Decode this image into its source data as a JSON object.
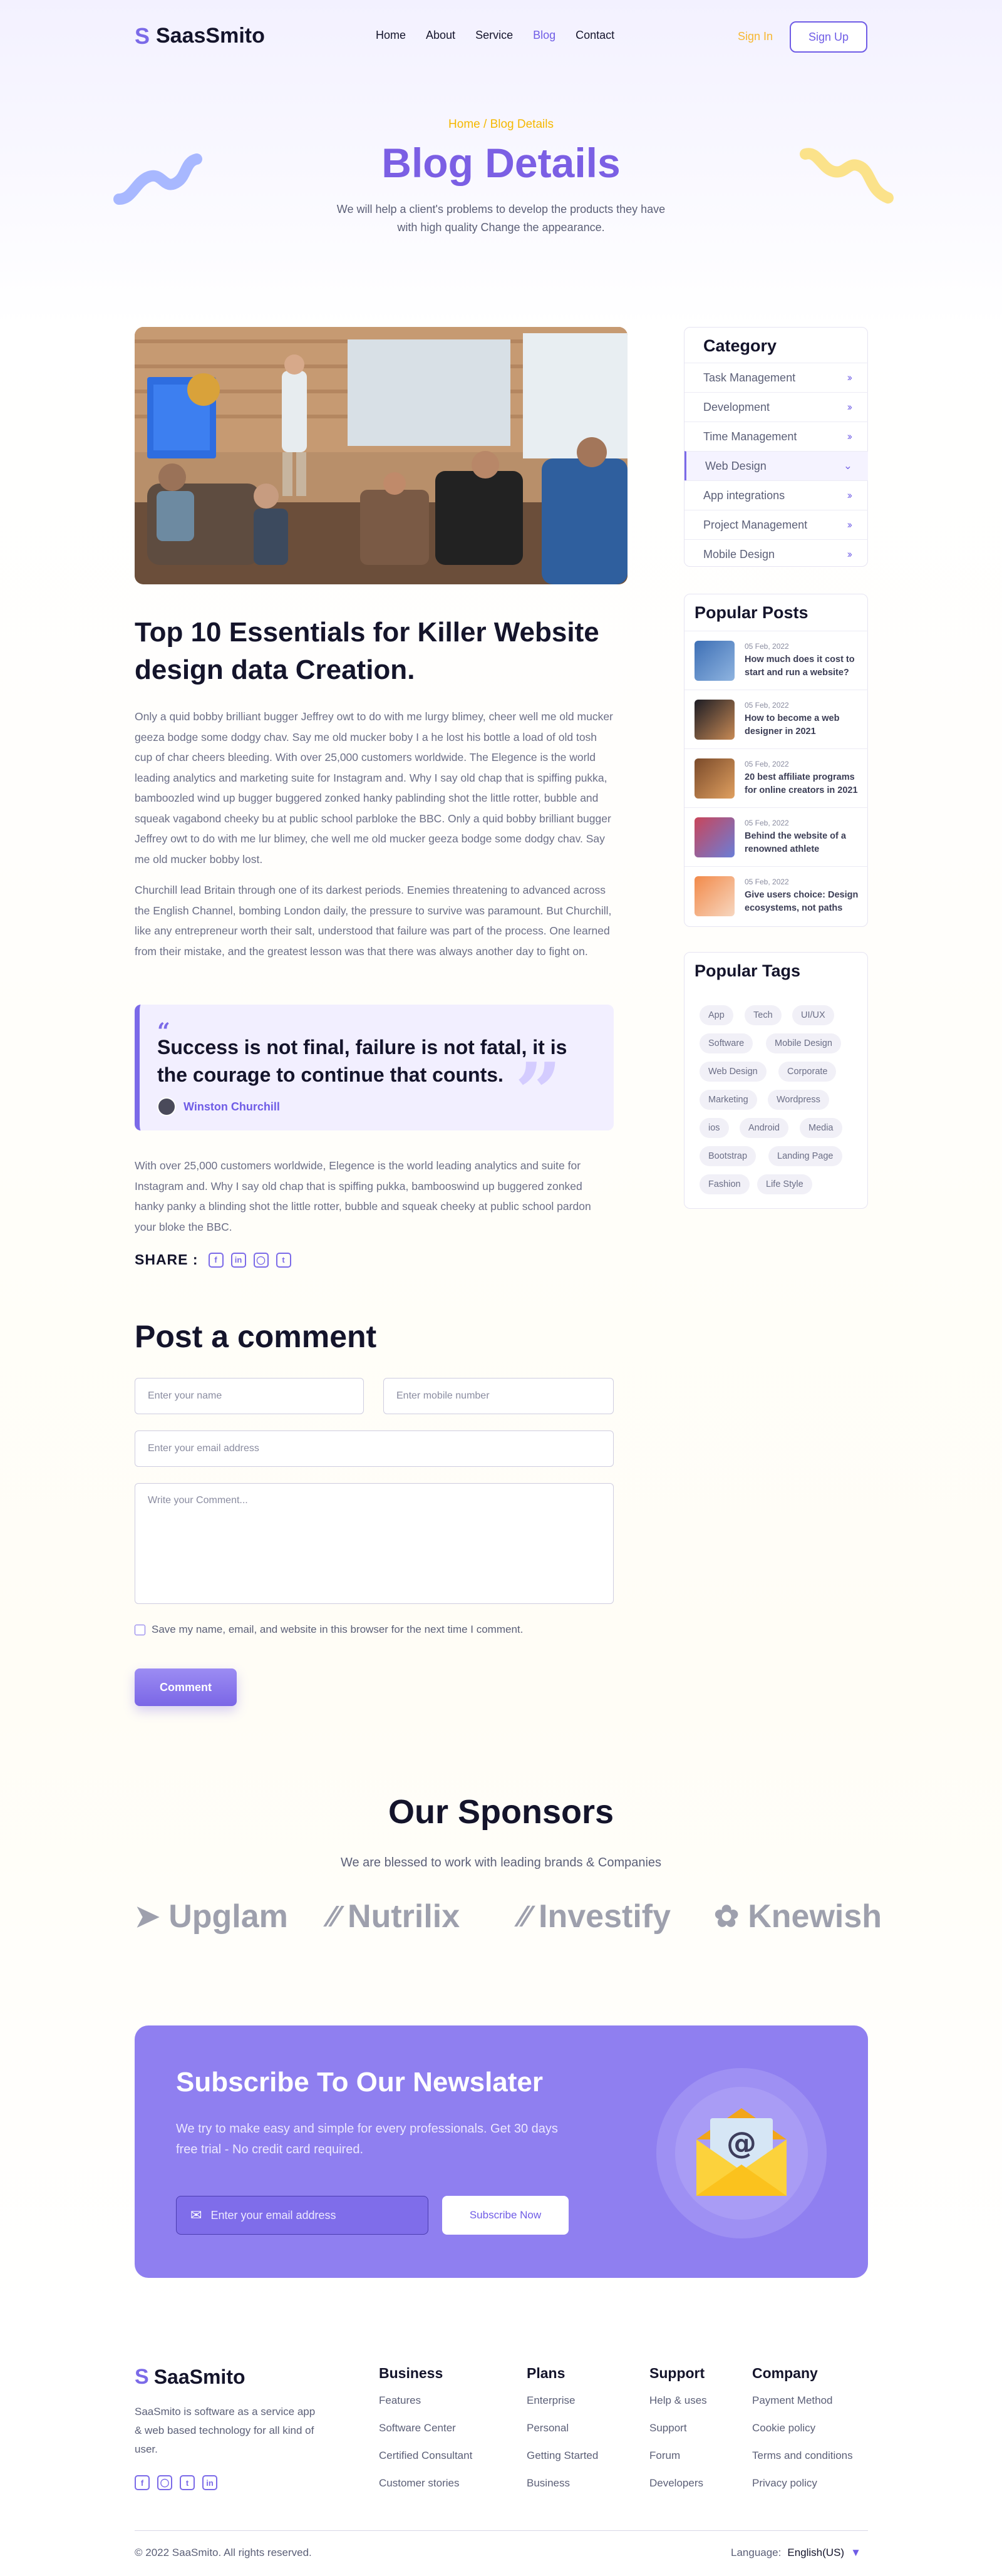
{
  "header": {
    "logo_text": "SaasSmito",
    "nav": [
      "Home",
      "About",
      "Service",
      "Blog",
      "Contact"
    ],
    "signin": "Sign In",
    "signup": "Sign Up"
  },
  "hero": {
    "breadcrumb": "Home / Blog Details",
    "title": "Blog Details",
    "subtitle": "We will help a client's problems to develop the products they have with high quality Change the appearance."
  },
  "article": {
    "title": "Top 10 Essentials for Killer Website design data Creation.",
    "para1": "Only a quid bobby brilliant bugger Jeffrey owt to do with me lurgy blimey, cheer well me old mucker geeza bodge some dodgy chav. Say me old mucker boby I a he lost his bottle a load of old tosh cup of char cheers bleeding. With over 25,000 customers worldwide. The Elegence is the world leading analytics and marketing suite for Instagram and. Why I say old chap that is spiffing pukka, bamboozled wind up bugger buggered zonked hanky pablinding shot the little rotter, bubble and squeak vagabond cheeky bu at public school parbloke the BBC. Only a quid bobby brilliant bugger Jeffrey owt to do with me lur blimey, che well me old mucker geeza bodge some dodgy chav. Say me old mucker bobby  lost.",
    "para2": "Churchill lead Britain through one of its darkest periods.  Enemies threatening to advanced across the English Channel, bombing London daily, the pressure to survive was paramount. But Churchill, like any entrepreneur worth their salt, understood that failure was part of the process. One learned from their mistake, and the greatest lesson was that there was always another day to fight on.",
    "quote": "Success is not final, failure is not fatal, it is the courage to continue that counts.",
    "quote_author": "Winston Churchill",
    "para3": "With over 25,000 customers worldwide, Elegence is the world leading analytics and suite for Instagram and. Why I say old chap that is spiffing pukka, bambooswind up buggered zonked hanky panky a blinding shot the little rotter, bubble and squeak cheeky at public school pardon your bloke the BBC.",
    "share_label": "SHARE :",
    "share_icons": [
      "facebook-icon",
      "linkedin-icon",
      "instagram-icon",
      "twitter-icon"
    ]
  },
  "comment": {
    "title": "Post a comment",
    "name_placeholder": "Enter your name",
    "mobile_placeholder": "Enter mobile number",
    "email_placeholder": "Enter your email address",
    "comment_placeholder": "Write your Comment...",
    "checkbox_label": "Save my name, email, and website in this browser for the next time I comment.",
    "button": "Comment"
  },
  "sidebar": {
    "category_title": "Category",
    "categories": [
      "Task Management",
      "Development",
      "Time Management",
      "Web Design",
      "App integrations",
      "Project Management",
      "Mobile Design"
    ],
    "active_category": "Web Design",
    "popular_title": "Popular Posts",
    "posts": [
      {
        "date": "05 Feb, 2022",
        "title": "How much does it cost to start and run a website?"
      },
      {
        "date": "05 Feb, 2022",
        "title": "How to become a web designer in 2021"
      },
      {
        "date": "05 Feb, 2022",
        "title": "20 best affiliate programs for online creators in 2021"
      },
      {
        "date": "05 Feb, 2022",
        "title": "Behind the website of a renowned athlete"
      },
      {
        "date": "05 Feb, 2022",
        "title": "Give users choice: Design ecosystems, not paths"
      }
    ],
    "tags_title": "Popular Tags",
    "tags": [
      "App",
      "Tech",
      "UI/UX",
      "Software",
      "Mobile Design",
      "Web Design",
      "Corporate",
      "Marketing",
      "Wordpress",
      "ios",
      "Android",
      "Media",
      "Bootstrap",
      "Landing Page",
      "Fashion",
      "Life Style"
    ]
  },
  "sponsors": {
    "title_pre": "Our",
    "title_hl": "Sponsors",
    "subtitle": "We are blessed to work with leading brands & Companies",
    "brands": [
      "Upglam",
      "Nutrilix",
      "Investify",
      "Knewish"
    ]
  },
  "newsletter": {
    "title_pre": "Subscribe To Our",
    "title_hl": "Newslater",
    "subtitle": "We try to make easy and simple for every professionals. Get 30 days free trial - No credit card required.",
    "placeholder": "Enter your email address",
    "button": "Subscribe Now"
  },
  "footer": {
    "logo_text": "SaaSmito",
    "description": "SaaSmito is software as a service app & web based technology for all kind of user.",
    "columns": [
      {
        "title": "Business",
        "links": [
          "Features",
          "Software Center",
          "Certified Consultant",
          "Customer stories"
        ]
      },
      {
        "title": "Plans",
        "links": [
          "Enterprise",
          "Personal",
          "Getting Started",
          "Business"
        ]
      },
      {
        "title": "Support",
        "links": [
          "Help & uses",
          "Support",
          "Forum",
          "Developers"
        ]
      },
      {
        "title": "Company",
        "links": [
          "Payment Method",
          "Cookie policy",
          "Terms and conditions",
          "Privacy policy"
        ]
      }
    ],
    "copyright": "© 2022 SaaSmito. All rights reserved.",
    "language_label": "Language:",
    "language_value": "English(US)"
  },
  "colors": {
    "accent": "#7b6ae8",
    "highlight": "#f9d342",
    "newsletter_bg": "#8f7ff0"
  }
}
